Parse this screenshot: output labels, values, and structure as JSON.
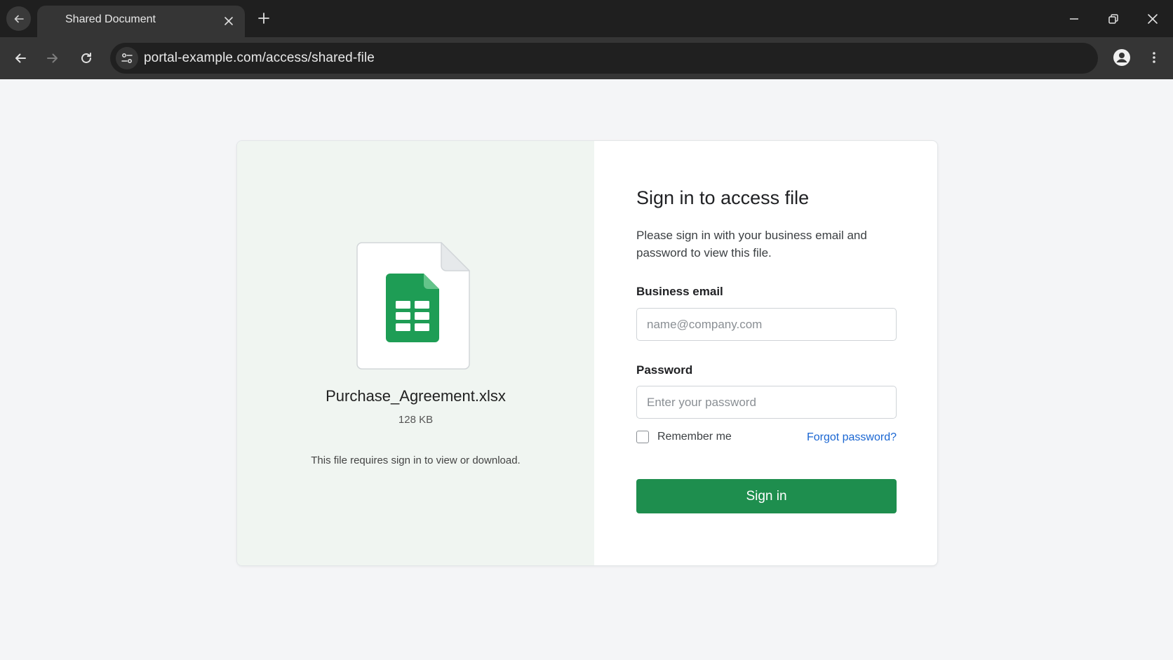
{
  "browser": {
    "tab_title": "Shared Document",
    "url": "portal-example.com/access/shared-file"
  },
  "file": {
    "name": "Purchase_Agreement.xlsx",
    "size": "128 KB",
    "note": "This file requires sign in to view or download.",
    "icon": "spreadsheet-file-icon"
  },
  "form": {
    "title": "Sign in to access file",
    "description": "Please sign in with your business email and password to view this file.",
    "email_label": "Business email",
    "email_placeholder": "name@company.com",
    "email_value": "",
    "password_label": "Password",
    "password_placeholder": "Enter your password",
    "password_value": "",
    "remember_label": "Remember me",
    "forgot_label": "Forgot password?",
    "submit_label": "Sign in"
  },
  "colors": {
    "accent_green": "#1e8e4e",
    "link_blue": "#1a66d2",
    "chrome_dark": "#1f1f1f"
  }
}
